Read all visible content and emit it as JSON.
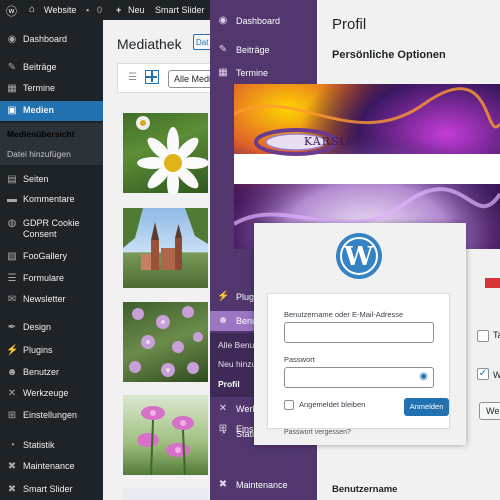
{
  "admin_bar": {
    "site_label": "Website",
    "comments_count": "0",
    "new_label": "Neu",
    "plugin_label": "Smart Slider"
  },
  "media_screen": {
    "menu": [
      {
        "label": "Dashboard",
        "icon": "dashboard-icon"
      },
      {
        "label": "Beiträge",
        "icon": "pin-icon"
      },
      {
        "label": "Termine",
        "icon": "calendar-icon"
      },
      {
        "label": "Medien",
        "icon": "media-icon",
        "active": true
      },
      {
        "label": "Seiten",
        "icon": "page-icon"
      },
      {
        "label": "Kommentare",
        "icon": "comment-icon"
      },
      {
        "label": "GDPR Cookie Consent",
        "icon": "gdpr-icon"
      },
      {
        "label": "FooGallery",
        "icon": "gallery-icon"
      },
      {
        "label": "Formulare",
        "icon": "forms-icon"
      },
      {
        "label": "Newsletter",
        "icon": "mail-icon"
      },
      {
        "label": "Design",
        "icon": "brush-icon"
      },
      {
        "label": "Plugins",
        "icon": "plugin-icon"
      },
      {
        "label": "Benutzer",
        "icon": "users-icon"
      },
      {
        "label": "Werkzeuge",
        "icon": "wrench-icon"
      },
      {
        "label": "Einstellungen",
        "icon": "settings-icon"
      },
      {
        "label": "Statistik",
        "icon": "chart-icon"
      },
      {
        "label": "Maintenance",
        "icon": "maintenance-icon"
      },
      {
        "label": "Smart Slider",
        "icon": "slider-icon"
      }
    ],
    "submenu": [
      "Medienübersicht",
      "Datei hinzufügen"
    ],
    "page_title": "Mediathek",
    "add_button": "Dat",
    "filter_label": "Alle Medi"
  },
  "profile_screen": {
    "menu": [
      {
        "label": "Dashboard",
        "icon": "dashboard-icon"
      },
      {
        "label": "Beiträge",
        "icon": "pin-icon"
      },
      {
        "label": "Termine",
        "icon": "calendar-icon"
      },
      {
        "label": "Plugi",
        "icon": "plugin-icon"
      },
      {
        "label": "Benu",
        "icon": "users-icon",
        "active": true
      },
      {
        "label": "Werk",
        "icon": "wrench-icon"
      },
      {
        "label": "Einst",
        "icon": "settings-icon"
      },
      {
        "label": "Stati",
        "icon": "chart-icon"
      },
      {
        "label": "Maintenance",
        "icon": "maintenance-icon"
      }
    ],
    "submenu": [
      "Alle Benu",
      "Neu hinzu",
      "Profil"
    ],
    "page_title": "Profil",
    "section_title": "Persönliche Optionen",
    "partial_labels": [
      "Ta",
      "W",
      "We"
    ],
    "bottom_label": "Benutzername"
  },
  "banner": {
    "logo_text": "KARSIA"
  },
  "login": {
    "username_label": "Benutzername oder E-Mail-Adresse",
    "password_label": "Passwort",
    "remember_label": "Angemeldet bleiben",
    "submit_label": "Anmelden",
    "lost_password": "Passwort vergessen?",
    "password_toggle_icon": "eye-icon",
    "colors": {
      "primary": "#2271b1",
      "logo": "#3582c4"
    }
  },
  "colors": {
    "dark_menu": "#1d2327",
    "purple_menu": "#52376f",
    "purple_active": "#9a76c3",
    "accent_blue": "#2271b1"
  }
}
